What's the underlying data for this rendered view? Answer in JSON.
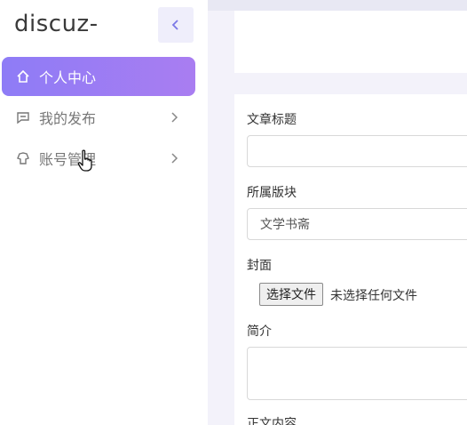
{
  "sidebar": {
    "brand": "discuz-",
    "collapse_icon": "chevron-left-icon",
    "items": [
      {
        "label": "个人中心",
        "icon": "home-icon",
        "active": true
      },
      {
        "label": "我的发布",
        "icon": "message-square-icon",
        "has_submenu": true
      },
      {
        "label": "账号管理",
        "icon": "shirt-icon",
        "has_submenu": true
      }
    ]
  },
  "form": {
    "title_label": "文章标题",
    "title_value": "",
    "section_label": "所属版块",
    "section_value": "文学书斋",
    "cover_label": "封面",
    "file_button": "选择文件",
    "file_status": "未选择任何文件",
    "summary_label": "简介",
    "content_label": "正文内容"
  },
  "colors": {
    "accent_start": "#8e7cf6",
    "accent_end": "#a97df1",
    "collapse_bg": "#efeefb"
  }
}
